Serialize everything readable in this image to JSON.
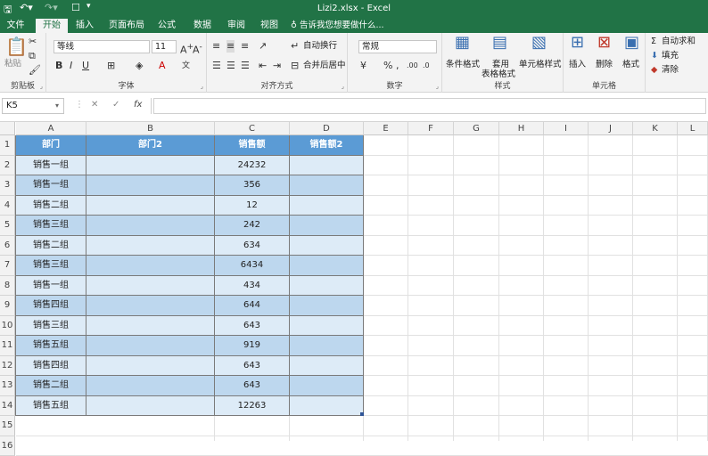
{
  "titlebar": {
    "title": "Lizi2.xlsx - Excel"
  },
  "tabs": {
    "file": "文件",
    "home": "开始",
    "insert": "插入",
    "layout": "页面布局",
    "formulas": "公式",
    "data": "数据",
    "review": "审阅",
    "view": "视图",
    "tell": "告诉我您想要做什么..."
  },
  "ribbon": {
    "clipboard": {
      "label": "剪贴板",
      "paste": "粘贴"
    },
    "font": {
      "label": "字体",
      "name": "等线",
      "size": "11"
    },
    "alignment": {
      "label": "对齐方式",
      "wrap": "自动换行",
      "merge": "合并后居中"
    },
    "number": {
      "label": "数字",
      "format": "常规"
    },
    "styles": {
      "label": "样式",
      "conditional": "条件格式",
      "table_l1": "套用",
      "table_l2": "表格格式",
      "cell_styles": "单元格样式"
    },
    "cells": {
      "label": "单元格",
      "insert": "插入",
      "delete": "删除",
      "format": "格式"
    },
    "editing": {
      "autosum": "自动求和",
      "fill": "填充",
      "clear": "清除"
    }
  },
  "formula_bar": {
    "name_box": "K5",
    "fx": "fx",
    "value": ""
  },
  "columns": [
    "A",
    "B",
    "C",
    "D",
    "E",
    "F",
    "G",
    "H",
    "I",
    "J",
    "K",
    "L"
  ],
  "rows": [
    "1",
    "2",
    "3",
    "4",
    "5",
    "6",
    "7",
    "8",
    "9",
    "10",
    "11",
    "12",
    "13",
    "14",
    "15",
    "16"
  ],
  "table": {
    "headers": [
      "部门",
      "部门2",
      "销售额",
      "销售额2"
    ],
    "rows": [
      [
        "销售一组",
        "",
        "24232",
        ""
      ],
      [
        "销售一组",
        "",
        "356",
        ""
      ],
      [
        "销售二组",
        "",
        "12",
        ""
      ],
      [
        "销售三组",
        "",
        "242",
        ""
      ],
      [
        "销售二组",
        "",
        "634",
        ""
      ],
      [
        "销售三组",
        "",
        "6434",
        ""
      ],
      [
        "销售一组",
        "",
        "434",
        ""
      ],
      [
        "销售四组",
        "",
        "644",
        ""
      ],
      [
        "销售三组",
        "",
        "643",
        ""
      ],
      [
        "销售五组",
        "",
        "919",
        ""
      ],
      [
        "销售四组",
        "",
        "643",
        ""
      ],
      [
        "销售二组",
        "",
        "643",
        ""
      ],
      [
        "销售五组",
        "",
        "12263",
        ""
      ]
    ]
  },
  "colors": {
    "excel_green": "#217346",
    "table_header": "#5b9bd5",
    "band_light": "#ddebf7",
    "band_dark": "#bdd7ee"
  }
}
